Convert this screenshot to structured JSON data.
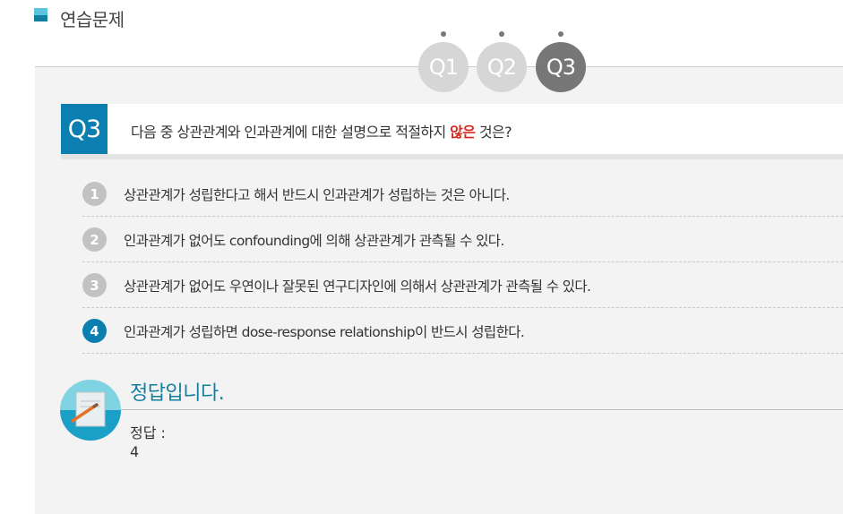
{
  "header": {
    "title": "연습문제"
  },
  "question_nav": [
    {
      "label": "Q1",
      "state": "inactive"
    },
    {
      "label": "Q2",
      "state": "inactive"
    },
    {
      "label": "Q3",
      "state": "active"
    }
  ],
  "question": {
    "badge": "Q3",
    "text_before": "다음 중 상관관계와 인과관계에 대한 설명으로 적절하지 ",
    "text_emphasis": "않은",
    "text_after": " 것은?"
  },
  "options": [
    {
      "number": "1",
      "text": "상관관계가 성립한다고 해서 반드시 인과관계가 성립하는 것은 아니다.",
      "selected": false
    },
    {
      "number": "2",
      "text": "인과관계가 없어도 confounding에 의해 상관관계가 관측될 수 있다.",
      "selected": false
    },
    {
      "number": "3",
      "text": "상관관계가 없어도 우연이나 잘못된 연구디자인에 의해서 상관관계가 관측될 수 있다.",
      "selected": false
    },
    {
      "number": "4",
      "text": "인과관계가 성립하면 dose-response relationship이 반드시 성립한다.",
      "selected": true
    }
  ],
  "answer": {
    "title": "정답입니다.",
    "label": "정답 :",
    "value": "4",
    "icon": "note-pencil-icon"
  },
  "colors": {
    "accent": "#0b7fb0",
    "accent_light": "#5bc5dc",
    "emphasis": "#d8281d",
    "nav_active": "#777777",
    "nav_inactive": "#d6d6d6"
  }
}
